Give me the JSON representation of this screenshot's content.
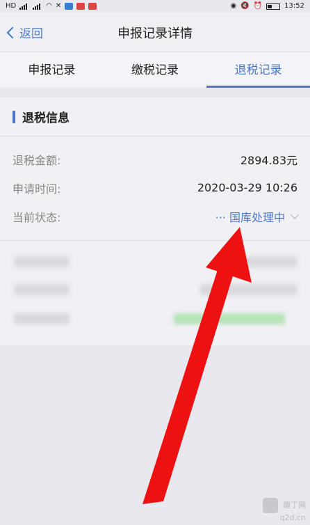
{
  "status_bar": {
    "left_label": "HD",
    "time": "13:52",
    "icons": [
      "signal-icon",
      "wifi-icon",
      "app-icon",
      "app-icon",
      "app-icon"
    ],
    "right_icons": [
      "eye-icon",
      "mute-icon",
      "alarm-icon",
      "battery-icon"
    ]
  },
  "nav": {
    "back_label": "返回",
    "title": "申报记录详情"
  },
  "tabs": [
    {
      "label": "申报记录",
      "active": false
    },
    {
      "label": "缴税记录",
      "active": false
    },
    {
      "label": "退税记录",
      "active": true
    }
  ],
  "section": {
    "title": "退税信息",
    "rows": [
      {
        "label": "退税金额:",
        "value": "2894.83元"
      },
      {
        "label": "申请时间:",
        "value": "2020-03-29 10:26"
      },
      {
        "label": "当前状态:",
        "value": "··· 国库处理中"
      }
    ]
  },
  "colors": {
    "accent": "#4a78c8",
    "arrow": "#ee1111",
    "background": "#e9e8ee"
  },
  "watermark": {
    "line1": "趣丁网",
    "line2": "q2d.cn"
  }
}
